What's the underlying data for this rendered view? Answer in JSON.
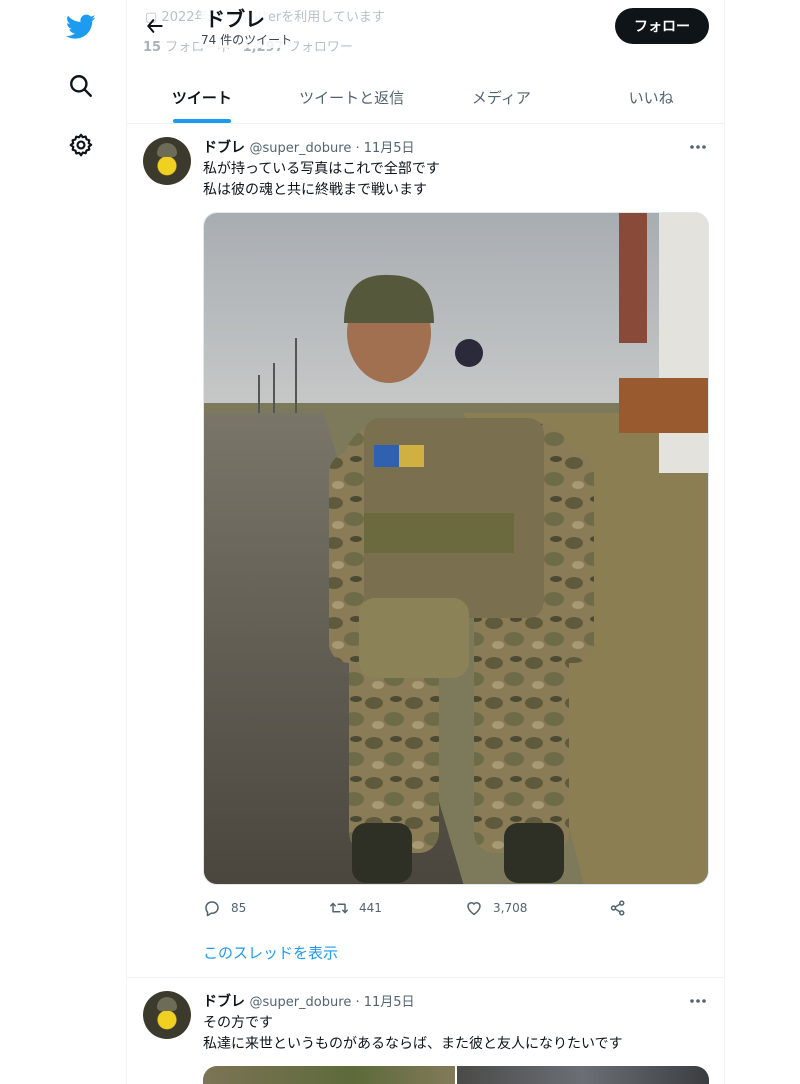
{
  "nav": {
    "icons": [
      "twitter-bird-icon",
      "search-icon",
      "gear-icon"
    ]
  },
  "header": {
    "ghost_joined": "2022年 からTwitterを利用しています",
    "ghost_following_count": "15",
    "ghost_following_label": " フォロー中",
    "ghost_followers_count": "1,297",
    "ghost_followers_label": " フォロワー",
    "name": "ドブレ",
    "tweet_count": "74 件のツイート",
    "follow_label": "フォロー"
  },
  "tabs": [
    {
      "label": "ツイート",
      "active": true
    },
    {
      "label": "ツイートと返信",
      "active": false
    },
    {
      "label": "メディア",
      "active": false
    },
    {
      "label": "いいね",
      "active": false
    }
  ],
  "tweets": [
    {
      "name": "ドブレ",
      "handle": "@super_dobure",
      "sep": " · ",
      "date": "11月5日",
      "line1": "私が持っている写真はこれで全部です",
      "line2": "私は彼の魂と共に終戦まで戦います",
      "replies": "85",
      "retweets": "441",
      "likes": "3,708",
      "thread_link": "このスレッドを表示"
    },
    {
      "name": "ドブレ",
      "handle": "@super_dobure",
      "sep": " · ",
      "date": "11月5日",
      "line1": "その方です",
      "line2": "私達に来世というものがあるならば、また彼と友人になりたいです"
    }
  ],
  "colors": {
    "accent": "#1d9bf0",
    "text": "#0f1419",
    "secondary": "#536471",
    "follow_bg": "#0f1419"
  }
}
